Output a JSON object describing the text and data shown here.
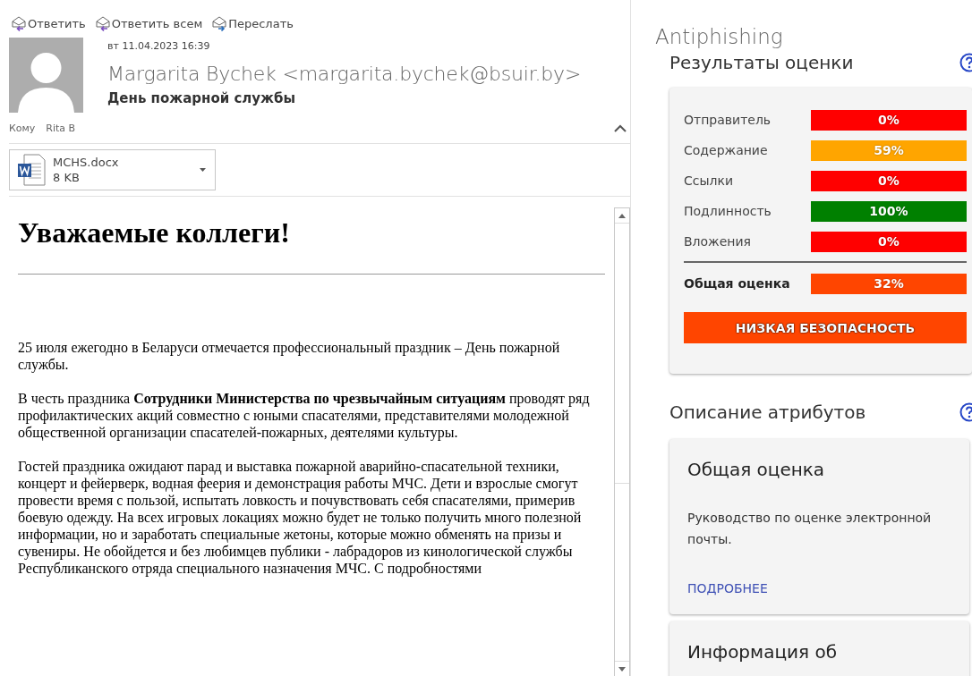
{
  "toolbar": [
    {
      "kind": "reply",
      "label": "Ответить"
    },
    {
      "kind": "reply_all",
      "label": "Ответить всем"
    },
    {
      "kind": "forward",
      "label": "Переслать"
    }
  ],
  "message": {
    "date": "вт 11.04.2023 16:39",
    "sender": "Margarita Bychek <margarita.bychek@bsuir.by>",
    "subject": "День пожарной службы",
    "to_label": "Кому",
    "to": "Rita B",
    "attachment": {
      "name": "MCHS.docx",
      "size": "8 KB"
    },
    "body": {
      "heading": "Уважаемые коллеги!",
      "paragraphs": [
        "25 июля ежегодно в Беларуси отмечается профессиональный праздник – День пожарной службы.",
        "В честь праздника **Сотрудники Министерства по чрезвычайным ситуациям** проводят ряд профилактических акций совместно  с юными спасателями, представителями молодежной общественной организации спасателей-пожарных, деятелями культуры.",
        "Гостей праздника ожидают парад и выставка пожарной аварийно-спасательной техники, концерт и фейерверк, водная феерия и демонстрация работы МЧС. Дети и взрослые смогут провести время с пользой, испытать ловкость и почувствовать себя спасателями, примерив боевую одежду. На всех игровых локациях можно будет не только получить много полезной информации, но и заработать специальные жетоны, которые можно обменять на призы и сувениры. Не обойдется и без любимцев публики - лабрадоров из кинологической службы Республиканского отряда специального назначения МЧС. С подробностями"
      ]
    }
  },
  "addin": {
    "title": "Antiphishing",
    "results": {
      "title": "Результаты оценки",
      "rows": [
        {
          "label": "Отправитель",
          "value": "0%",
          "color": "#ff0000"
        },
        {
          "label": "Содержание",
          "value": "59%",
          "color": "#ffa500"
        },
        {
          "label": "Ссылки",
          "value": "0%",
          "color": "#ff0000"
        },
        {
          "label": "Подлинность",
          "value": "100%",
          "color": "#008000"
        },
        {
          "label": "Вложения",
          "value": "0%",
          "color": "#ff0000"
        }
      ],
      "total": {
        "label": "Общая оценка",
        "value": "32%",
        "color": "#ff4500"
      },
      "verdict": {
        "text": "НИЗКАЯ БЕЗОПАСНОСТЬ",
        "color": "#ff4500"
      }
    },
    "attributes": {
      "title": "Описание атрибутов",
      "cards": [
        {
          "title": "Общая оценка",
          "text": "Руководство по оценке электронной почты.",
          "link": "ПОДРОБНЕЕ"
        },
        {
          "title": "Информация об"
        }
      ]
    }
  }
}
